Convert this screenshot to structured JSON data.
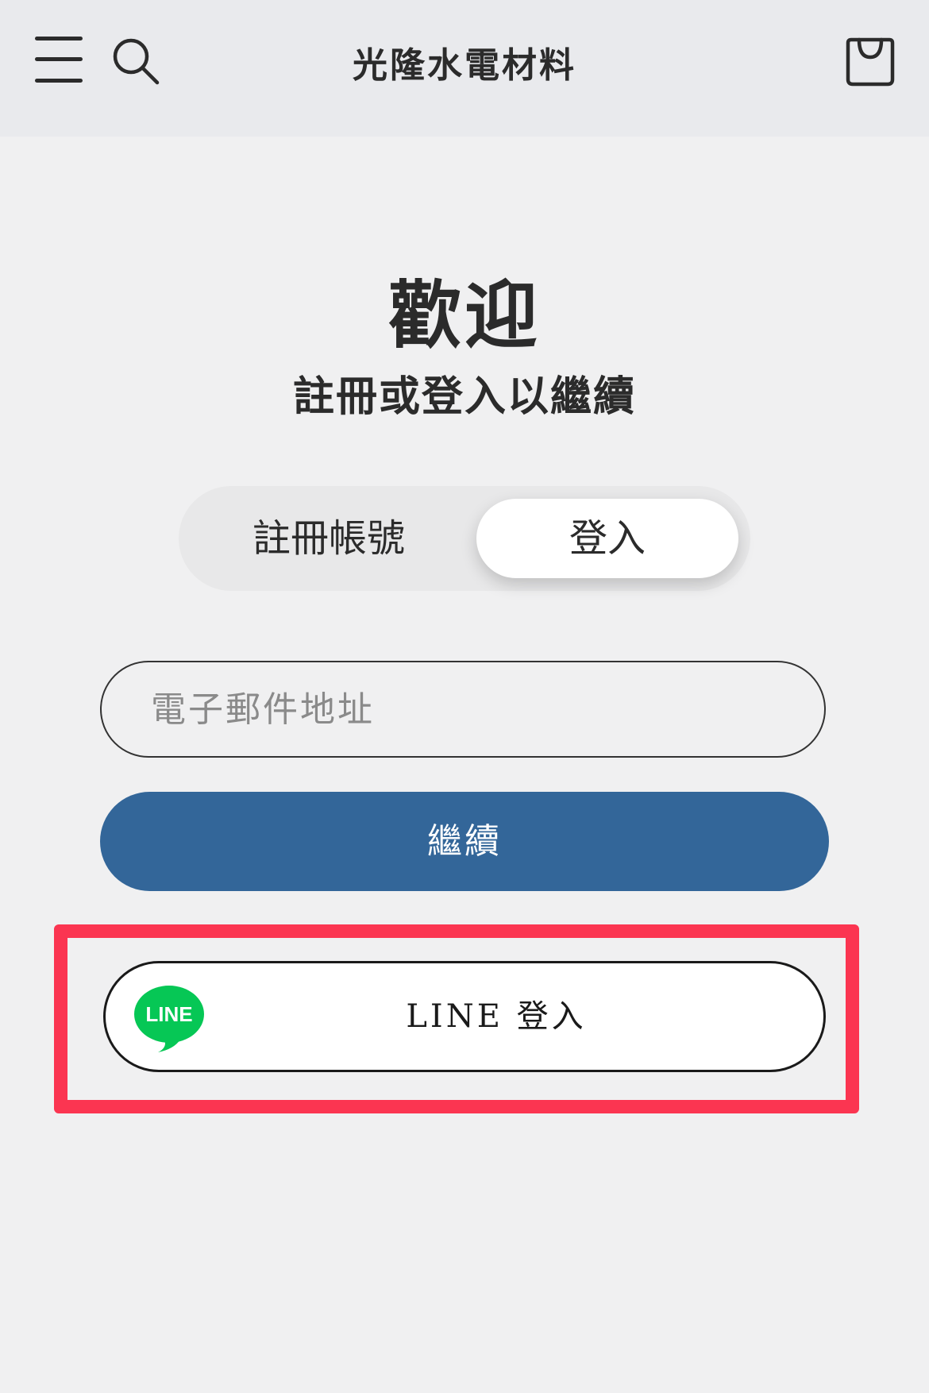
{
  "header": {
    "title": "光隆水電材料"
  },
  "welcome": {
    "title": "歡迎",
    "subtitle": "註冊或登入以繼續"
  },
  "toggle": {
    "register_label": "註冊帳號",
    "login_label": "登入",
    "selected": "登入"
  },
  "email": {
    "placeholder": "電子郵件地址",
    "value": ""
  },
  "continue_button": {
    "label": "繼續"
  },
  "line_login": {
    "label": "LINE 登入",
    "logo_text": "LINE"
  },
  "colors": {
    "header_bg": "#e9eaed",
    "page_bg": "#f0f0f1",
    "primary": "#336699",
    "highlight": "#fb3551",
    "line_green": "#06c755"
  },
  "icons": {
    "menu": "hamburger-menu-icon",
    "search": "search-icon",
    "cart": "shopping-bag-icon",
    "line": "line-logo-icon"
  }
}
